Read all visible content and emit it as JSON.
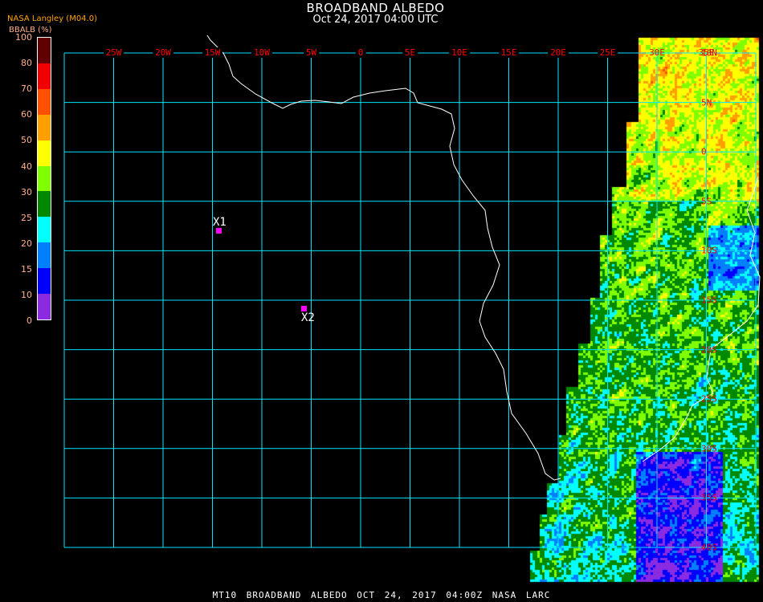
{
  "header": {
    "title": "BROADBAND ALBEDO",
    "subtitle": "Oct 24, 2017 04:00 UTC",
    "org": "NASA Langley (M04.0)",
    "unit_label": "BBALB (%)"
  },
  "legend": {
    "ticks": [
      "100",
      "80",
      "70",
      "60",
      "50",
      "40",
      "30",
      "25",
      "20",
      "15",
      "10",
      "0"
    ],
    "colors": [
      "#600000",
      "#f00000",
      "#ff5000",
      "#ffa000",
      "#ffff00",
      "#80ff00",
      "#008800",
      "#00ffff",
      "#0080ff",
      "#0000ff",
      "#8a2be2"
    ]
  },
  "grid": {
    "color": "#00e5ff",
    "lon_labels": [
      "25W",
      "20W",
      "15W",
      "10W",
      "5W",
      "0",
      "5E",
      "10E",
      "15E",
      "20E",
      "25E",
      "30E",
      "35E"
    ],
    "lat_labels": [
      "10N",
      "5N",
      "0",
      "5S",
      "10S",
      "15S",
      "20S",
      "25S",
      "30S",
      "35S",
      "40S"
    ]
  },
  "markers": [
    {
      "label": "X1",
      "color": "#ff00ff"
    },
    {
      "label": "X2",
      "color": "#ff00ff"
    }
  ],
  "footer": "MT10  BROADBAND ALBEDO   OCT 24, 2017 04:00Z   NASA LARC"
}
